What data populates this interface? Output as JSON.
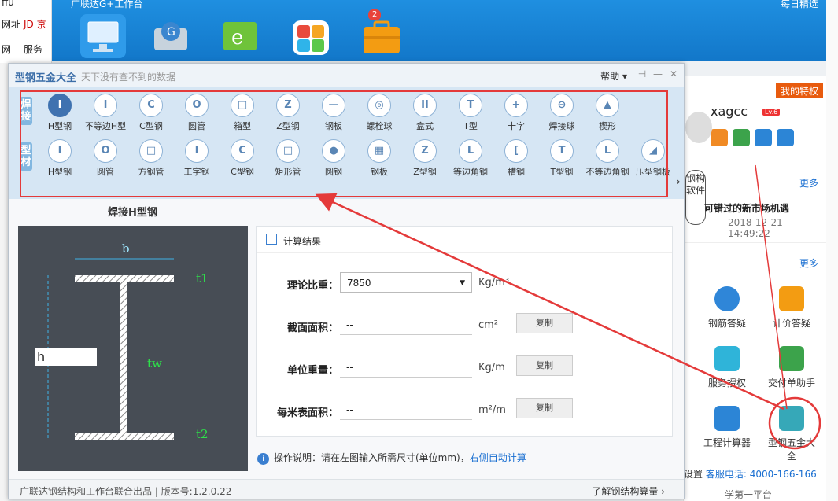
{
  "background": {
    "left_items": [
      "ffu",
      "网址",
      "JD 京",
      "网",
      "服务",
      "刂",
      "关"
    ],
    "taskbar_title": "广联达G+工作台",
    "taskbar_right": "每日精选",
    "badge_count": "2"
  },
  "right_panel": {
    "vip": "我的特权",
    "username": "xagcc",
    "level": "Lv.6",
    "more1": "更多",
    "news": "可错过的新市场机遇",
    "date": "2018-12-21 14:49:22",
    "more2": "更多",
    "tiles": [
      "钢筋答疑",
      "计价答疑",
      "服务授权",
      "交付单助手",
      "工程计算器",
      "型钢五金大全"
    ],
    "mascot_text": "钢构软件",
    "footer_settings": "设置",
    "footer_phone": "客服电话: 4000-166-166",
    "footer_bottom": "学第一平台"
  },
  "dialog": {
    "title": "型钢五金大全",
    "subtitle": "天下没有查不到的数据",
    "help": "帮助",
    "categories": [
      "焊接",
      "型材"
    ],
    "row1": [
      "H型钢",
      "不等边H型",
      "C型钢",
      "圆管",
      "箱型",
      "Z型钢",
      "钢板",
      "螺栓球",
      "盒式",
      "T型",
      "十字",
      "焊接球",
      "楔形"
    ],
    "row1_icons": [
      "I",
      "I",
      "C",
      "O",
      "□",
      "Z",
      "—",
      "◎",
      "II",
      "T",
      "+",
      "⊖",
      "▲"
    ],
    "row2": [
      "H型钢",
      "圆管",
      "方钢管",
      "工字钢",
      "C型钢",
      "矩形管",
      "圆钢",
      "钢板",
      "Z型钢",
      "等边角钢",
      "槽钢",
      "T型钢",
      "不等边角钢",
      "压型钢板"
    ],
    "row2_icons": [
      "I",
      "O",
      "□",
      "I",
      "C",
      "□",
      "●",
      "▦",
      "Z",
      "L",
      "[",
      "T",
      "L",
      "◢"
    ],
    "section_title": "焊接H型钢",
    "diagram_labels": {
      "b": "b",
      "t1": "t1",
      "tw": "tw",
      "t2": "t2",
      "h": "h"
    },
    "results": {
      "header": "计算结果",
      "rows": [
        {
          "label": "理论比重：",
          "value": "7850",
          "unit": "Kg/m³",
          "copy": ""
        },
        {
          "label": "截面面积：",
          "value": "--",
          "unit": "cm²",
          "copy": "复制"
        },
        {
          "label": "单位重量：",
          "value": "--",
          "unit": "Kg/m",
          "copy": "复制"
        },
        {
          "label": "每米表面积：",
          "value": "--",
          "unit": "m²/m",
          "copy": "复制"
        }
      ]
    },
    "note": "操作说明：请在左图输入所需尺寸(单位mm)，",
    "note_link": "右侧自动计算",
    "footer_left": "广联达钢结构和工作台联合出品  |  版本号:1.2.0.22",
    "footer_right": "了解钢结构算量"
  },
  "colors": {
    "accent": "#3f72b0",
    "annotation_red": "#e43a3a",
    "diagram_bg": "#474d55",
    "dim_green": "#2ee04a"
  }
}
